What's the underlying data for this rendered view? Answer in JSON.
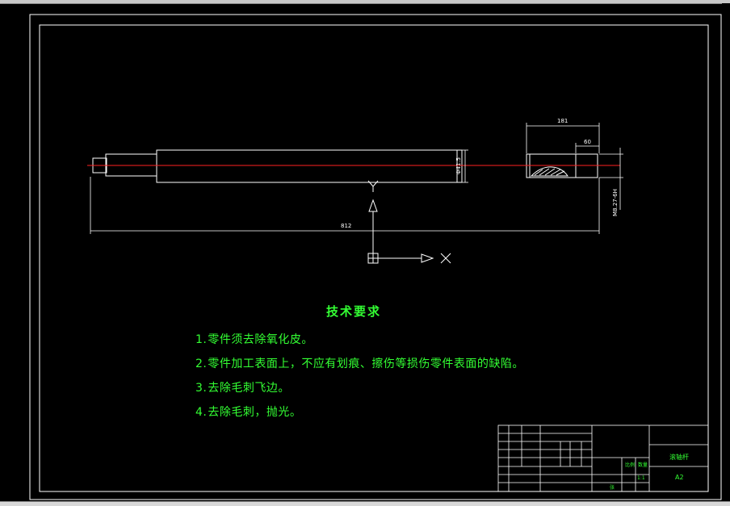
{
  "drawing": {
    "dim_total_length": "812",
    "dim_right_section": "181",
    "dim_right_end": "60",
    "dim_vertical_diameter": "Φ41.5",
    "dim_vertical_right": "M8.27-6H",
    "ucs_x_label": "X",
    "ucs_y_label": "Y"
  },
  "tech_requirements": {
    "title": "技术要求",
    "items": [
      {
        "num": "1.",
        "text": "零件须去除氧化皮。"
      },
      {
        "num": "2.",
        "text": "零件加工表面上，不应有划痕、擦伤等损伤零件表面的缺陷。"
      },
      {
        "num": "3.",
        "text": "去除毛刺飞边。"
      },
      {
        "num": "4.",
        "text": "去除毛刺，抛光。"
      }
    ]
  },
  "title_block": {
    "part_name": "滚轴杆",
    "material": "A2",
    "scale_label": "比例",
    "qty_label": "数量",
    "sheet_label": "张",
    "scale_value": "1:1"
  },
  "colors": {
    "background": "#000000",
    "frame": "#ffffff",
    "text_green": "#33ff33",
    "centerline": "#ff2020",
    "dimension": "#ffffff"
  }
}
